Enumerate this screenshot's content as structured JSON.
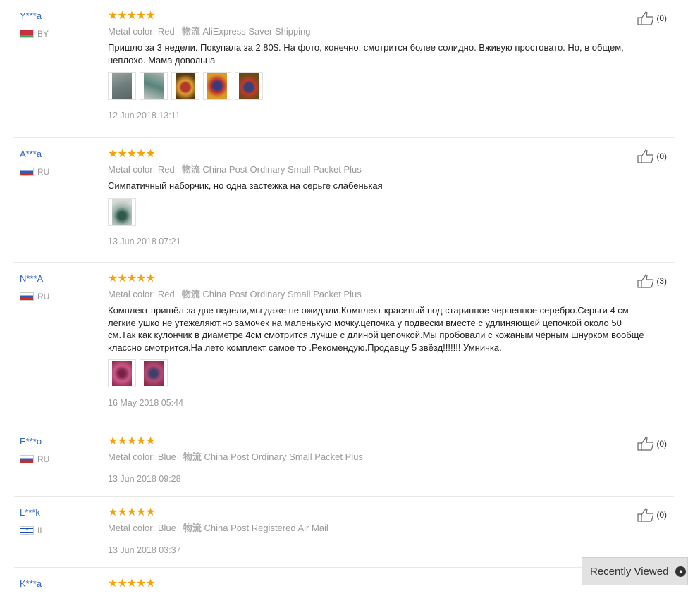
{
  "reviews": [
    {
      "user": "Y***a",
      "country": "BY",
      "flag": "by",
      "stars": "★★★★★",
      "color_label": "Metal color:",
      "color_value": "Red",
      "ship_label": "物流",
      "ship_value": "AliExpress Saver Shipping",
      "text": "Пришло за 3 недели. Покупала за 2,80$. На фото, конечно, смотрится более солидно. Вживую простовато. Но, в общем, неплохо. Мама довольна",
      "helpful": "(0)",
      "date": "12 Jun 2018 13:11"
    },
    {
      "user": "A***a",
      "country": "RU",
      "flag": "ru",
      "stars": "★★★★★",
      "color_label": "Metal color:",
      "color_value": "Red",
      "ship_label": "物流",
      "ship_value": "China Post Ordinary Small Packet Plus",
      "text": "Симпатичный наборчик, но одна застежка на серьге слабенькая",
      "helpful": "(0)",
      "date": "13 Jun 2018 07:21"
    },
    {
      "user": "N***A",
      "country": "RU",
      "flag": "ru",
      "stars": "★★★★★",
      "color_label": "Metal color:",
      "color_value": "Red",
      "ship_label": "物流",
      "ship_value": "China Post Ordinary Small Packet Plus",
      "text": "Комплект пришёл за две недели,мы даже не ожидали.Комплект красивый под старинное черненное серебро.Серьги 4 см - лёгкие ушко не утежеляют,но замочек на маленькую мочку.цепочка у подвески вместе с удлиняющей цепочкой около 50 см.Так как кулончик в диаметре 4см смотрится лучше с длиной цепочкой.Мы пробовали с кожаным чёрным шнурком вообще классно смотрится.На лето комплект самое то .Рекомендую.Продавцу 5 звёзд!!!!!!! Умничка.",
      "helpful": "(3)",
      "date": "16 May 2018 05:44"
    },
    {
      "user": "E***o",
      "country": "RU",
      "flag": "ru",
      "stars": "★★★★★",
      "color_label": "Metal color:",
      "color_value": "Blue",
      "ship_label": "物流",
      "ship_value": "China Post Ordinary Small Packet Plus",
      "helpful": "(0)",
      "date": "13 Jun 2018 09:28"
    },
    {
      "user": "L***k",
      "country": "IL",
      "flag": "il",
      "stars": "★★★★★",
      "color_label": "Metal color:",
      "color_value": "Blue",
      "ship_label": "物流",
      "ship_value": "China Post Registered Air Mail",
      "helpful": "(0)",
      "date": "13 Jun 2018 03:37"
    },
    {
      "user": "K***a",
      "stars": "★★★★★"
    }
  ],
  "recently_viewed": {
    "label": "Recently Viewed",
    "icon": "chevron-up-icon"
  },
  "colors": {
    "star": "#f4a209",
    "username": "#3066be",
    "muted": "#999999"
  }
}
